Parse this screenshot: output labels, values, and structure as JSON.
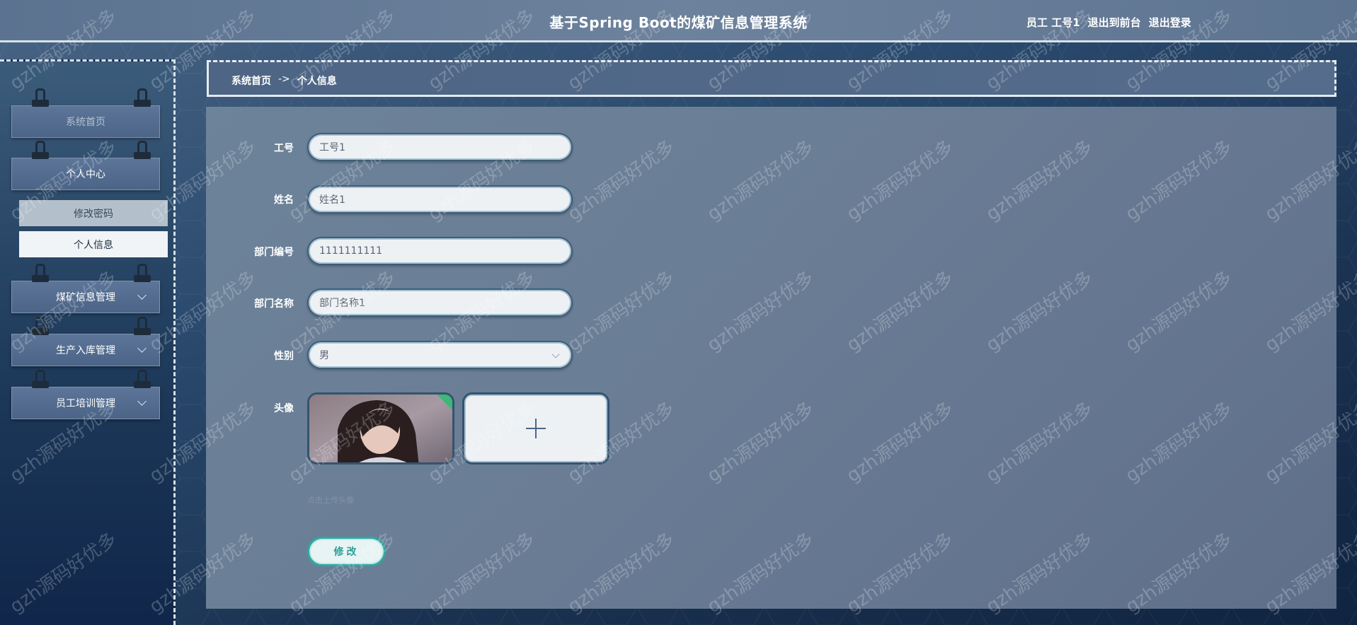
{
  "header": {
    "title": "基于Spring Boot的煤矿信息管理系统",
    "user_label": "员工 工号1",
    "to_front_label": "退出到前台",
    "logout_label": "退出登录"
  },
  "sidebar": {
    "items": [
      {
        "label": "系统首页"
      },
      {
        "label": "个人中心"
      },
      {
        "label": "煤矿信息管理"
      },
      {
        "label": "生产入库管理"
      },
      {
        "label": "员工培训管理"
      }
    ],
    "sub_items": [
      {
        "label": "修改密码"
      },
      {
        "label": "个人信息"
      }
    ]
  },
  "breadcrumb": {
    "home": "系统首页",
    "separator": "->",
    "current": "个人信息"
  },
  "form": {
    "fields": [
      {
        "label": "工号",
        "value": "工号1"
      },
      {
        "label": "姓名",
        "value": "姓名1"
      },
      {
        "label": "部门编号",
        "value": "1111111111"
      },
      {
        "label": "部门名称",
        "value": "部门名称1"
      },
      {
        "label": "性别",
        "value": "男"
      }
    ],
    "avatar_label": "头像",
    "upload_icon": "plus-icon",
    "upload_hint": "点击上传头像",
    "submit_label": "修改"
  },
  "watermark_text": "gzh源码好优多",
  "colors": {
    "header_border": "#d7e1ea",
    "submit_accent": "#31a7a0",
    "input_border": "#3e5d78"
  }
}
